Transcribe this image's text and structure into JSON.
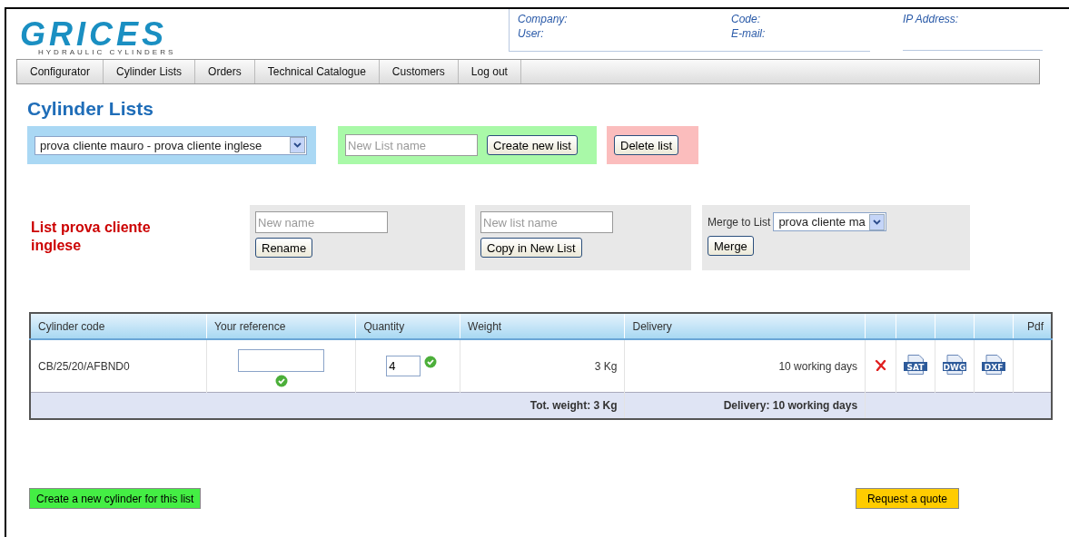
{
  "logo": {
    "name": "GRICES",
    "tagline": "HYDRAULIC CYLINDERS"
  },
  "account": {
    "company": "Company:",
    "user": "User:",
    "code": "Code:",
    "email": "E-mail:",
    "ip": "IP Address:"
  },
  "nav": [
    {
      "label": "Configurator"
    },
    {
      "label": "Cylinder Lists"
    },
    {
      "label": "Orders"
    },
    {
      "label": "Technical Catalogue"
    },
    {
      "label": "Customers"
    },
    {
      "label": "Log out"
    }
  ],
  "title": "Cylinder Lists",
  "list_select": {
    "value": "prova cliente mauro - prova cliente inglese"
  },
  "create": {
    "placeholder": "New List name",
    "button": "Create new list"
  },
  "delete": {
    "button": "Delete list"
  },
  "list_heading": "List prova cliente inglese",
  "rename": {
    "placeholder": "New name",
    "button": "Rename"
  },
  "copy": {
    "placeholder": "New list name",
    "button": "Copy in New List"
  },
  "merge": {
    "label": "Merge to List",
    "value": "prova cliente ma",
    "button": "Merge"
  },
  "table": {
    "columns": [
      "Cylinder code",
      "Your reference",
      "Quantity",
      "Weight",
      "Delivery",
      "",
      "",
      "",
      "",
      "Pdf"
    ],
    "rows": [
      {
        "code": "CB/25/20/AFBND0",
        "reference": "",
        "quantity": "4",
        "weight": "3 Kg",
        "delivery": "10 working days",
        "files": [
          "SAT",
          "DWG",
          "DXF"
        ]
      }
    ],
    "total_weight": "Tot. weight: 3 Kg",
    "total_delivery": "Delivery: 10 working days"
  },
  "new_cylinder_button": "Create a new cylinder for this list",
  "quote_button": "Request a quote"
}
